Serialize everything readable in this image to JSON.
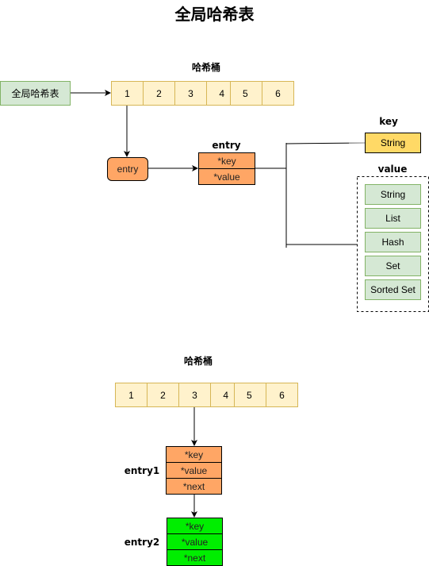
{
  "title": "全局哈希表",
  "global_table_label": "全局哈希表",
  "top_section": {
    "bucket_label": "哈希桶",
    "buckets": [
      "1",
      "2",
      "3",
      "4",
      "5",
      "6"
    ],
    "entry_node_label": "entry",
    "entry_struct": {
      "title": "entry",
      "fields": [
        "*key",
        "*value"
      ]
    },
    "key_group": {
      "title": "key",
      "types": [
        "String"
      ]
    },
    "value_group": {
      "title": "value",
      "types": [
        "String",
        "List",
        "Hash",
        "Set",
        "Sorted Set"
      ]
    }
  },
  "bottom_section": {
    "bucket_label": "哈希桶",
    "buckets": [
      "1",
      "2",
      "3",
      "4",
      "5",
      "6"
    ],
    "entries": [
      {
        "name": "entry1",
        "fields": [
          "*key",
          "*value",
          "*next"
        ],
        "color": "#ffa665"
      },
      {
        "name": "entry2",
        "fields": [
          "*key",
          "*value",
          "*next"
        ],
        "color": "#00ee00"
      }
    ]
  },
  "colors": {
    "bucket_fill": "#fff2cc",
    "bucket_stroke": "#d6b656",
    "green_fill": "#d5e8d4",
    "green_stroke": "#82b366",
    "entry_orange": "#ffa665",
    "key_yellow": "#ffd966"
  }
}
